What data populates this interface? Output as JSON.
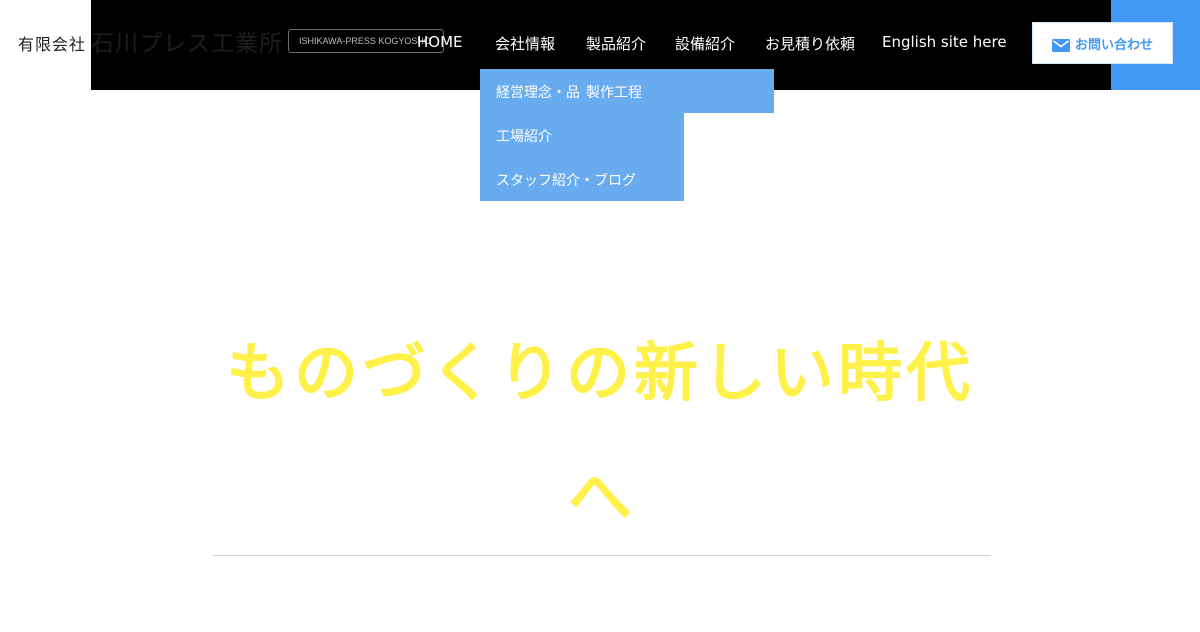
{
  "brand": {
    "company_prefix": "有限会社",
    "company_name": "石川プレス工業所",
    "english_badge": "ISHIKAWA-PRESS KOGYOSHO"
  },
  "nav": {
    "items": [
      {
        "label": "HOME"
      },
      {
        "label": "会社情報"
      },
      {
        "label": "製品紹介"
      },
      {
        "label": "設備紹介"
      },
      {
        "label": "お見積り依頼"
      },
      {
        "label": "English site here"
      }
    ],
    "contact_label": "お問い合わせ"
  },
  "dropdown": {
    "items": [
      {
        "label": "経営理念・品"
      },
      {
        "label": "製作工程"
      },
      {
        "label": "工場紹介"
      },
      {
        "label": "スタッフ紹介・ブログ"
      }
    ]
  },
  "hero": {
    "line1": "ものづくりの新しい時代",
    "line2": "へ"
  },
  "colors": {
    "header_bg": "#000000",
    "accent_blue": "#4199f5",
    "dropdown_bg": "#68abef",
    "hero_text": "#fff04a"
  }
}
